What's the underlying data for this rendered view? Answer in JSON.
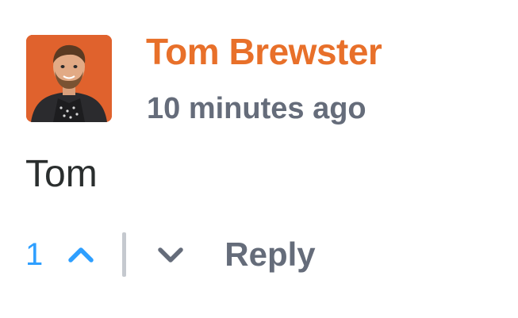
{
  "comment": {
    "author": "Tom Brewster",
    "timestamp": "10 minutes ago",
    "text": "Tom",
    "votes": "1",
    "reply_label": "Reply"
  },
  "icons": {
    "upvote": "chevron-up-icon",
    "downvote": "chevron-down-icon"
  },
  "colors": {
    "author": "#e8702a",
    "meta": "#656c7a",
    "vote_active": "#2e9fff",
    "divider": "#c5c9cf",
    "avatar_bg": "#e0622d"
  }
}
